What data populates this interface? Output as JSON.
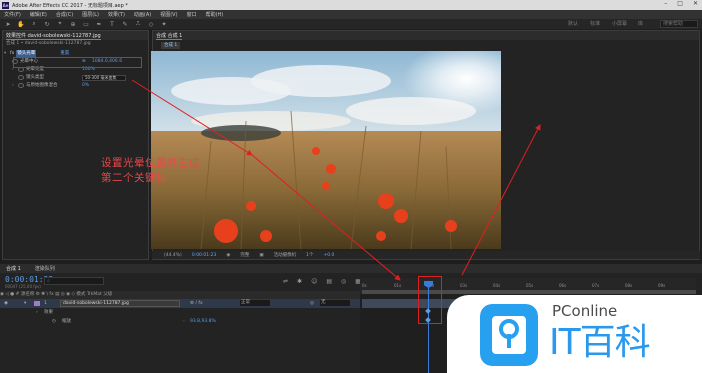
{
  "window": {
    "title": "Adobe After Effects CC 2017 - 无标题项目.aep *",
    "app_icon": "Ae"
  },
  "menu": [
    "文件(F)",
    "编辑(E)",
    "合成(C)",
    "图层(L)",
    "效果(T)",
    "动画(A)",
    "视图(V)",
    "窗口",
    "帮助(H)"
  ],
  "toolbar": {
    "workspace_items": [
      "默认",
      "标准",
      "小屏幕",
      "库"
    ],
    "search_placeholder": "搜索帮助"
  },
  "effect_controls": {
    "tab_label": "效果控件 david-sobolewski-112787.jpg",
    "subheader": "合成 1 • david-sobolewski-112787.jpg",
    "effect_name": "镜头光晕",
    "reset_label": "重置",
    "properties": [
      {
        "name": "光晕中心",
        "value": "1084.0,406.6"
      },
      {
        "name": "光晕亮度",
        "value": "100%"
      },
      {
        "name": "镜头类型",
        "value": "50-300 毫米变焦"
      },
      {
        "name": "与原始图像混合",
        "value": "0%"
      }
    ]
  },
  "composition": {
    "tab_label": "合成 合成 1",
    "breadcrumb": "合成 1",
    "footer": {
      "zoom": "(44.4%)",
      "timecode": "0:00:01:23",
      "resolution": "完整",
      "camera": "活动摄像机",
      "views": "1个",
      "exposure": "+0.0"
    }
  },
  "annotation": {
    "line1": "设置光晕位置并生成",
    "line2": "第二个关键帧"
  },
  "timeline": {
    "tabs": [
      "合成 1",
      "渲染队列"
    ],
    "timecode": "0:00:01:23",
    "fps_info": "00047 (25.00 fps)",
    "search_placeholder": "",
    "columns": {
      "source_name": "源名称",
      "mode": "模式",
      "trkmat": "TrkMat",
      "parent": "父级"
    },
    "layer": {
      "number": "1",
      "name": "david-sobolewski-112787.jpg",
      "mode": "正常",
      "parent": "无"
    },
    "effects_label": "效果",
    "property": {
      "name": "缩放",
      "value": "93.8,93.8%"
    },
    "ruler_labels": [
      "0s",
      "01s",
      "02s",
      "03s",
      "04s",
      "05s",
      "06s",
      "07s",
      "08s",
      "09s"
    ]
  },
  "watermark": {
    "brand": "PConline",
    "tagline": "IT百科"
  },
  "colors": {
    "accent_blue": "#5b9ee8",
    "annotation_red": "#e84a4a",
    "logo_blue": "#27a0f0"
  }
}
